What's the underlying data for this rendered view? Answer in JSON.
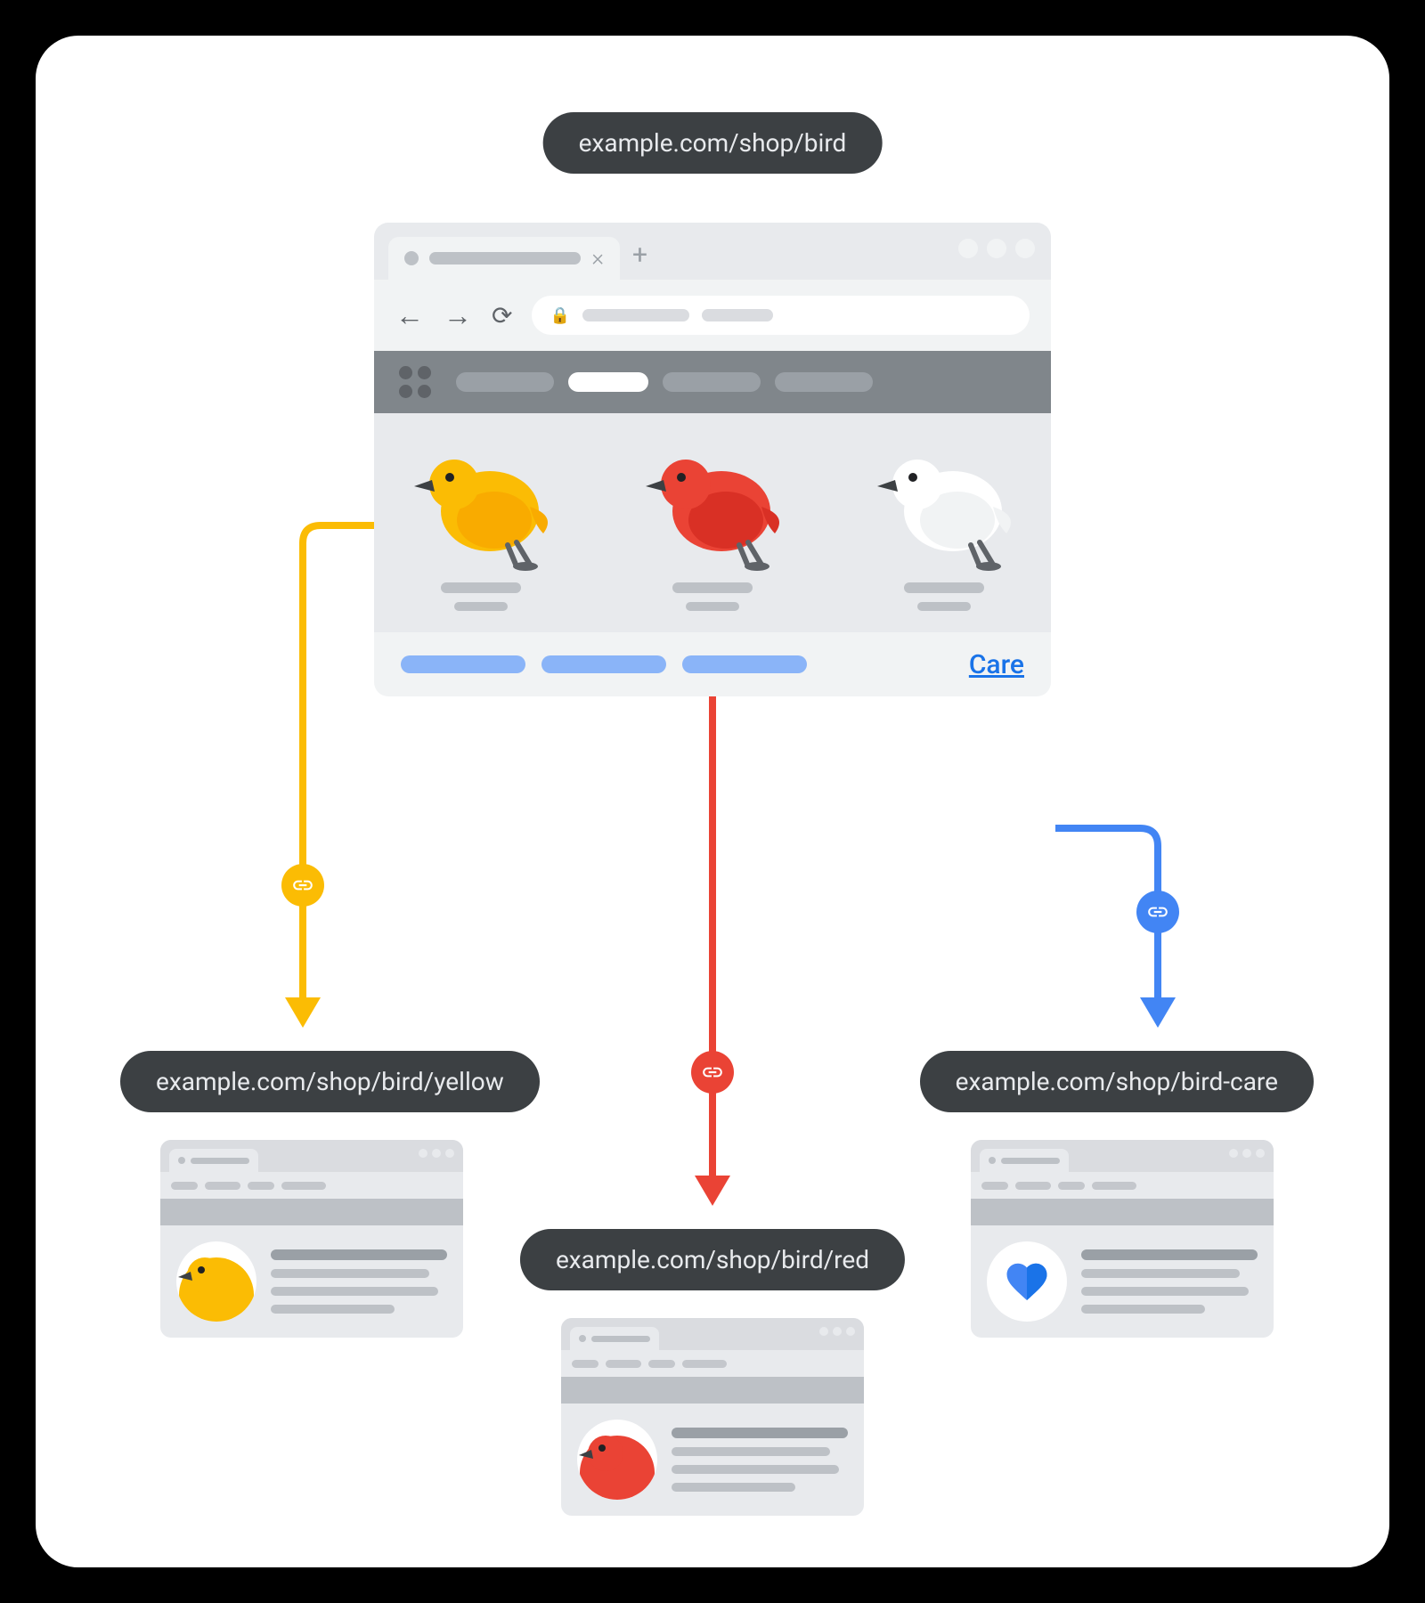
{
  "urls": {
    "parent": "example.com/shop/bird",
    "yellow": "example.com/shop/bird/yellow",
    "red": "example.com/shop/bird/red",
    "care": "example.com/shop/bird-care"
  },
  "careLinkLabel": "Care",
  "colors": {
    "yellow": "#fbbc04",
    "red": "#ea4335",
    "blue": "#4285f4",
    "linkBlue": "#1a73e8",
    "pillBg": "#3c4043"
  },
  "birds": [
    "yellow",
    "red",
    "white"
  ]
}
